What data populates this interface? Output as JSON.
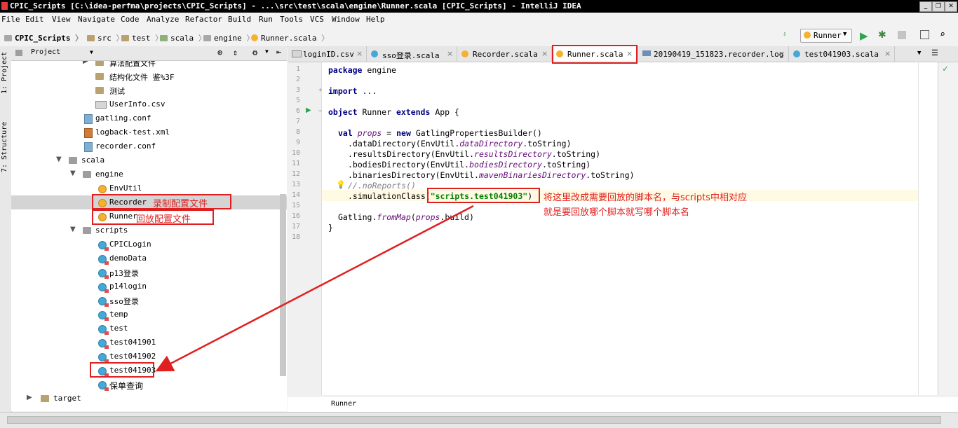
{
  "window": {
    "title": "CPIC_Scripts [C:\\idea-perfma\\projects\\CPIC_Scripts] - ...\\src\\test\\scala\\engine\\Runner.scala [CPIC_Scripts] - IntelliJ IDEA",
    "controls": {
      "minimize": "_",
      "restore": "❐",
      "close": "✕"
    }
  },
  "menu": [
    "File",
    "Edit",
    "View",
    "Navigate",
    "Code",
    "Analyze",
    "Refactor",
    "Build",
    "Run",
    "Tools",
    "VCS",
    "Window",
    "Help"
  ],
  "breadcrumbs": [
    "CPIC_Scripts",
    "src",
    "test",
    "scala",
    "engine",
    "Runner.scala"
  ],
  "run_config": {
    "label": "Runner"
  },
  "sidebar": {
    "project_tab": "1: Project",
    "structure_tab": "7: Structure"
  },
  "project_panel": {
    "title": "Project",
    "tree": [
      {
        "label": "算法配置文件",
        "type": "folder"
      },
      {
        "label": "结构化文件 鉴%3F",
        "type": "folder"
      },
      {
        "label": "测试",
        "type": "folder"
      },
      {
        "label": "UserInfo.csv",
        "type": "csv"
      },
      {
        "label": "gatling.conf",
        "type": "conf"
      },
      {
        "label": "logback-test.xml",
        "type": "xml"
      },
      {
        "label": "recorder.conf",
        "type": "conf"
      },
      {
        "label": "scala",
        "type": "folder-gray"
      },
      {
        "label": "engine",
        "type": "folder-gray"
      },
      {
        "label": "EnvUtil",
        "type": "object"
      },
      {
        "label": "Recorder",
        "type": "object"
      },
      {
        "label": "Runner",
        "type": "object"
      },
      {
        "label": "scripts",
        "type": "folder-gray"
      },
      {
        "label": "CPICLogin",
        "type": "class"
      },
      {
        "label": "demoData",
        "type": "class"
      },
      {
        "label": "p13登录",
        "type": "class"
      },
      {
        "label": "p14login",
        "type": "class"
      },
      {
        "label": "sso登录",
        "type": "class"
      },
      {
        "label": "temp",
        "type": "class"
      },
      {
        "label": "test",
        "type": "class"
      },
      {
        "label": "test041901",
        "type": "class"
      },
      {
        "label": "test041902",
        "type": "class"
      },
      {
        "label": "test041903",
        "type": "class"
      },
      {
        "label": "保单查询",
        "type": "class"
      },
      {
        "label": "target",
        "type": "folder"
      }
    ]
  },
  "tabs": [
    "loginID.csv",
    "sso登录.scala",
    "Recorder.scala",
    "Runner.scala",
    "20190419_151823.recorder.log",
    "test041903.scala"
  ],
  "editor": {
    "line_numbers": [
      "1",
      "2",
      "3",
      "5",
      "6",
      "7",
      "8",
      "9",
      "10",
      "11",
      "12",
      "13",
      "14",
      "15",
      "16",
      "17",
      "18"
    ],
    "lines": {
      "l1_kw": "package",
      "l1_rest": " engine",
      "l3_kw": "import",
      "l3_rest": " ...",
      "l6_kw1": "object",
      "l6_a": " Runner ",
      "l6_kw2": "extends",
      "l6_b": " App {",
      "l8_kw1": "val",
      "l8_it": "props",
      "l8_a": " = ",
      "l8_kw2": "new",
      "l8_b": " GatlingPropertiesBuilder()",
      "l9_a": ".dataDirectory(EnvUtil.",
      "l9_it": "dataDirectory",
      "l9_b": ".toString)",
      "l10_a": ".resultsDirectory(EnvUtil.",
      "l10_it": "resultsDirectory",
      "l10_b": ".toString)",
      "l11_a": ".bodiesDirectory(EnvUtil.",
      "l11_it": "bodiesDirectory",
      "l11_b": ".toString)",
      "l12_a": ".binariesDirectory(EnvUtil.",
      "l12_it": "mavenBinariesDirectory",
      "l12_b": ".toString)",
      "l13": "//.noReports()",
      "l14_a": ".simulationClass(",
      "l14_str": "\"scripts.test041903\"",
      "l14_b": ")",
      "l16_a": "Gatling.",
      "l16_it": "fromMap",
      "l16_b": "(",
      "l16_it2": "props",
      "l16_c": ".build)",
      "l17": "}"
    },
    "footer_breadcrumb": "Runner"
  },
  "annotations": {
    "recorder": "录制配置文件",
    "runner": "回放配置文件",
    "note_line1": "将这里改成需要回放的脚本名，与scripts中相对应",
    "note_line2": "就是要回放哪个脚本就写哪个脚本名"
  },
  "colors": {
    "annotation": "#e02020",
    "keyword": "#000080",
    "string": "#008000",
    "field": "#660e7a"
  }
}
